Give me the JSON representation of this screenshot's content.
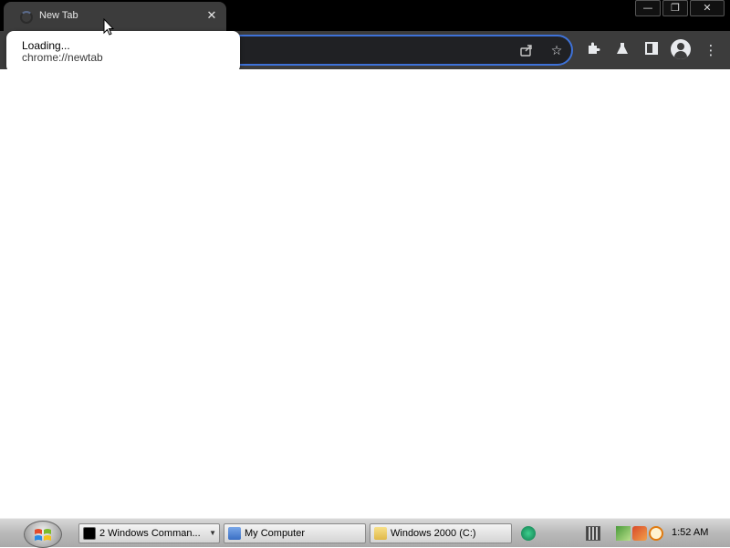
{
  "browser": {
    "tab": {
      "title": "New Tab",
      "spinner_icon": "loading-spinner-icon"
    },
    "tooltip": {
      "title": "Loading...",
      "url": "chrome://newtab"
    },
    "window_controls": {
      "minimize_icon": "minimize-icon",
      "restore_icon": "restore-icon",
      "close_icon": "close-icon"
    },
    "omnibox_icons": [
      "share-icon",
      "bookmark-star-icon"
    ],
    "toolbar_icons": [
      "extensions-icon",
      "labs-flask-icon",
      "side-panel-icon",
      "profile-icon",
      "menu-icon"
    ]
  },
  "taskbar": {
    "items": [
      {
        "label": "2 Windows Comman...",
        "icon": "command-prompt-icon",
        "grouped": true
      },
      {
        "label": "My Computer",
        "icon": "my-computer-icon",
        "grouped": false
      },
      {
        "label": "Windows 2000 (C:)",
        "icon": "folder-icon",
        "grouped": false
      }
    ],
    "clock": "1:52 AM"
  }
}
